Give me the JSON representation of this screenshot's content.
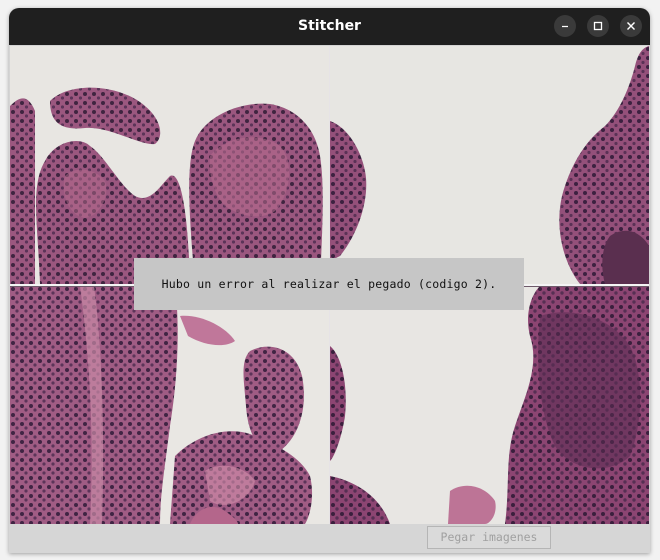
{
  "window": {
    "title": "Stitcher"
  },
  "titlebar_buttons": {
    "minimize_icon": "minimize-icon",
    "maximize_icon": "maximize-icon",
    "close_icon": "close-icon"
  },
  "canvas": {
    "tiles": [
      {
        "name": "stitch-tile-1",
        "content": "histology micrograph, villi, top-left"
      },
      {
        "name": "stitch-tile-2",
        "content": "histology micrograph, villus edge, top-right"
      },
      {
        "name": "stitch-tile-3",
        "content": "histology micrograph, villi, bottom-left"
      },
      {
        "name": "stitch-tile-4",
        "content": "histology micrograph, dense tissue, bottom-right"
      }
    ],
    "tissue_color": "#8e4a78",
    "background_color": "#e9e7e4"
  },
  "error": {
    "message": "Hubo un error al realizar el pegado (codigo 2)."
  },
  "toolbar": {
    "paste_label": "Pegar imagenes",
    "paste_enabled": false
  },
  "colors": {
    "titlebar": "#1f1f1f",
    "window_bg": "#d4d4d4",
    "overlay_bg": "#c6c6c6",
    "disabled_text": "#a0a0a0"
  }
}
